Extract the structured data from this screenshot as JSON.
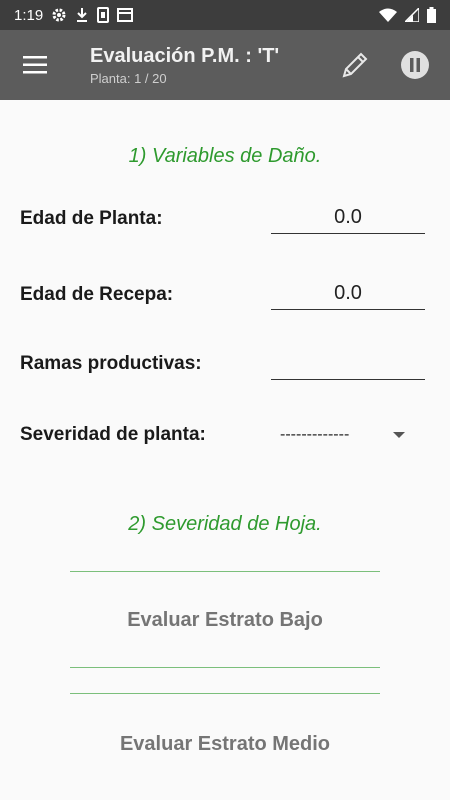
{
  "status_bar": {
    "time": "1:19",
    "left_icons": [
      "gear-icon",
      "download-icon",
      "sim-icon",
      "calendar-icon"
    ],
    "right_icons": [
      "wifi-icon",
      "signal-icon",
      "battery-icon"
    ]
  },
  "toolbar": {
    "title": "Evaluación P.M. : 'T'",
    "subtitle": "Planta: 1 / 20",
    "icons": [
      "menu-icon",
      "pencil-icon",
      "pause-icon"
    ]
  },
  "section1": {
    "title": "1) Variables de Daño."
  },
  "fields": {
    "edad_planta": {
      "label": "Edad de Planta:",
      "value": "0.0"
    },
    "edad_recepa": {
      "label": "Edad de Recepa:",
      "value": "0.0"
    },
    "ramas": {
      "label": "Ramas productivas:",
      "value": ""
    },
    "severidad": {
      "label": "Severidad de planta:",
      "selected": "-------------"
    }
  },
  "section2": {
    "title": "2) Severidad de Hoja."
  },
  "buttons": {
    "bajo": "Evaluar Estrato Bajo",
    "medio": "Evaluar Estrato Medio"
  },
  "colors": {
    "accent": "#2e9a2e",
    "toolbar": "#5c5c5c",
    "statusbar": "#3d3d3d"
  }
}
